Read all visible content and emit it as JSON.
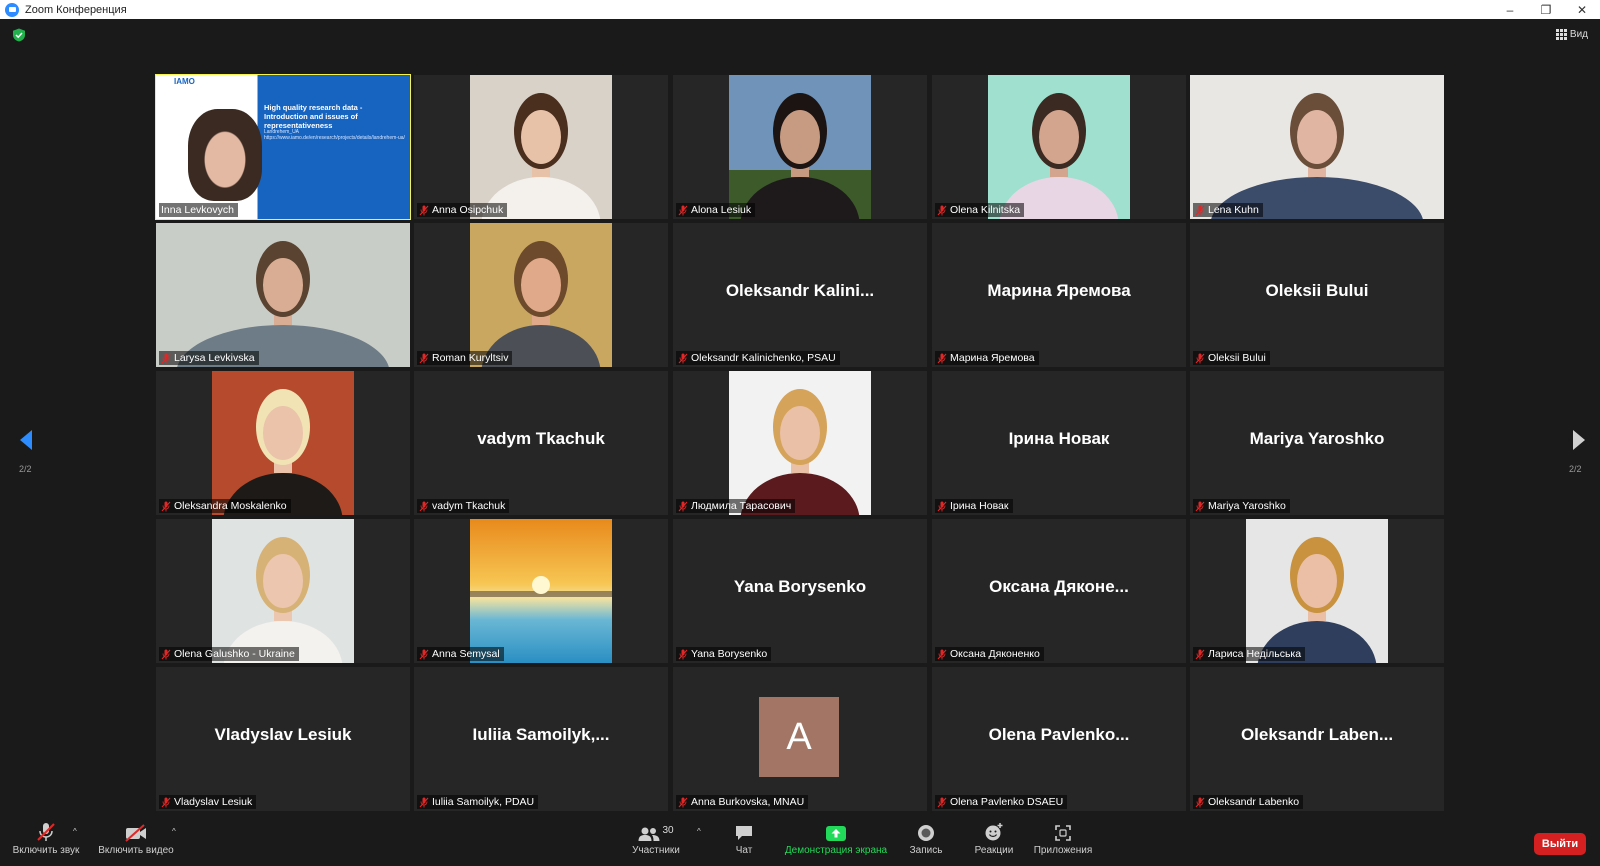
{
  "window": {
    "title": "Zoom Конференция",
    "controls": [
      "–",
      "❐",
      "✕"
    ]
  },
  "view_button": {
    "label": "Вид"
  },
  "pagination": {
    "left": "2/2",
    "right": "2/2"
  },
  "participants": [
    {
      "display": "",
      "label": "Inna Levkovych",
      "media": "shared-screen",
      "active": true,
      "slide": {
        "logo": "IAMO",
        "title": "High quality research data - Introduction and issues of representativeness",
        "subtitle": "Landrehem_UA",
        "url": "https://www.iamo.de/en/research/projects/details/landrehem-ua/"
      }
    },
    {
      "display": "",
      "label": "Anna Osipchuk",
      "media": "photo",
      "bg": "#d9d2c9",
      "skin": "#e8c2a8",
      "hair": "#4a2e1e",
      "shirt": "#f4f1ec"
    },
    {
      "display": "",
      "label": "Alona Lesiuk",
      "media": "photo",
      "bg": "#6f93b9",
      "skin": "#c79a82",
      "hair": "#1c1412",
      "shirt": "#1e1a1c",
      "ground": "#3d5a2a"
    },
    {
      "display": "",
      "label": "Olena Kilnitska",
      "media": "photo",
      "bg": "#9fe0cf",
      "skin": "#d3a58e",
      "hair": "#3b2a22",
      "shirt": "#e8d6e4"
    },
    {
      "display": "",
      "label": "Lena Kuhn",
      "media": "photo-wide",
      "bg": "#e9e7e3",
      "skin": "#e0b6a2",
      "hair": "#6b4e3a",
      "shirt": "#3b4b6a"
    },
    {
      "display": "",
      "label": "Larysa Levkivska",
      "media": "photo-wide",
      "bg": "#c9cdc7",
      "skin": "#d9ad93",
      "hair": "#5a4330",
      "shirt": "#6d7c86"
    },
    {
      "display": "",
      "label": "Roman Kuryltsiv",
      "media": "photo",
      "bg": "#c9a760",
      "skin": "#e0a98a",
      "hair": "#6c4a2b",
      "shirt": "#4c5056"
    },
    {
      "display": "Oleksandr Kalini...",
      "label": "Oleksandr Kalinichenko, PSAU",
      "media": "none"
    },
    {
      "display": "Марина Яремова",
      "label": "Марина Яремова",
      "media": "none"
    },
    {
      "display": "Oleksii Bului",
      "label": "Oleksii Bului",
      "media": "none"
    },
    {
      "display": "",
      "label": "Oleksandra Moskalenko",
      "media": "photo",
      "bg": "#b54a2c",
      "skin": "#eac3aa",
      "hair": "#f1e3b4",
      "shirt": "#1e1a18"
    },
    {
      "display": "vadym Tkachuk",
      "label": "vadym Tkachuk",
      "media": "none"
    },
    {
      "display": "",
      "label": "Людмила Тарасович",
      "media": "photo",
      "bg": "#f2f2f2",
      "skin": "#eac0a6",
      "hair": "#d5a35a",
      "shirt": "#5a1a1e"
    },
    {
      "display": "Ірина Новак",
      "label": "Ірина Новак",
      "media": "none"
    },
    {
      "display": "Mariya Yaroshko",
      "label": "Mariya Yaroshko",
      "media": "none"
    },
    {
      "display": "",
      "label": "Olena Galushko - Ukraine",
      "media": "photo",
      "bg": "#dfe4e3",
      "skin": "#ecc6ae",
      "hair": "#d7b276",
      "shirt": "#f4f2ee"
    },
    {
      "display": "",
      "label": "Anna Semysal",
      "media": "sunset"
    },
    {
      "display": "Yana Borysenko",
      "label": "Yana Borysenko",
      "media": "none"
    },
    {
      "display": "Оксана Дяконе...",
      "label": "Оксана Дяконенко",
      "media": "none"
    },
    {
      "display": "",
      "label": "Лариса Недільська",
      "media": "photo",
      "bg": "#e6e6e6",
      "skin": "#ebbfa6",
      "hair": "#c8923f",
      "shirt": "#2e3e5c"
    },
    {
      "display": "Vladyslav Lesiuk",
      "label": "Vladyslav Lesiuk",
      "media": "none"
    },
    {
      "display": "Iuliia  Samoilyk,...",
      "label": "Iuliia Samoilyk, PDAU",
      "media": "none"
    },
    {
      "display": "",
      "label": "Anna Burkovska, MNAU",
      "media": "avatar",
      "avatar_letter": "A"
    },
    {
      "display": "Olena  Pavlenko...",
      "label": "Olena Pavlenko DSAEU",
      "media": "none"
    },
    {
      "display": "Oleksandr  Laben...",
      "label": "Oleksandr Labenko",
      "media": "none"
    }
  ],
  "toolbar": {
    "unmute": "Включить звук",
    "start_video": "Включить видео",
    "participants": "Участники",
    "participants_count": "30",
    "chat": "Чат",
    "share_screen": "Демонстрация экрана",
    "record": "Запись",
    "reactions": "Реакции",
    "apps": "Приложения",
    "leave": "Выйти"
  },
  "colors": {
    "active_border": "#f7f34c",
    "share_green": "#23d959",
    "leave_red": "#d42020",
    "mute_red": "#e02828",
    "nav_blue": "#2d8cff"
  }
}
